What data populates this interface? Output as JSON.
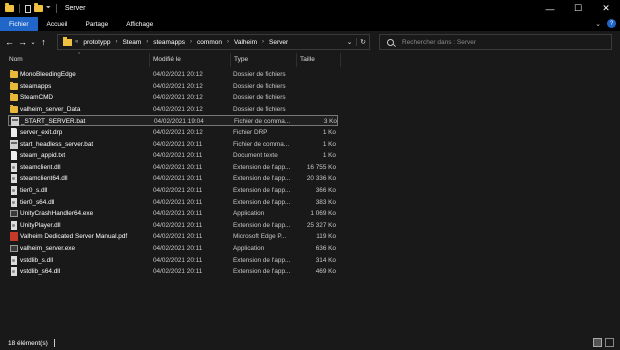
{
  "window": {
    "title": "Server",
    "controls": {
      "minimize": "—",
      "maximize": "☐",
      "close": "✕"
    }
  },
  "ribbon": {
    "tabs": [
      {
        "label": "Fichier",
        "active": true
      },
      {
        "label": "Accueil",
        "active": false
      },
      {
        "label": "Partage",
        "active": false
      },
      {
        "label": "Affichage",
        "active": false
      }
    ],
    "collapse_glyph": "⌄",
    "help_glyph": "?"
  },
  "nav": {
    "back": "←",
    "forward": "→",
    "history": "⌄",
    "up": "↑",
    "more_glyph": "«",
    "breadcrumbs": [
      "prototypp",
      "Steam",
      "steamapps",
      "common",
      "Valheim",
      "Server"
    ],
    "crumb_separator": "›",
    "dropdown_glyph": "⌄",
    "refresh_glyph": "↻"
  },
  "search": {
    "placeholder": "Rechercher dans : Server"
  },
  "columns": {
    "name": "Nom",
    "modified": "Modifié le",
    "type": "Type",
    "size": "Taille"
  },
  "files": [
    {
      "name": "MonoBleedingEdge",
      "modified": "04/02/2021 20:12",
      "type": "Dossier de fichiers",
      "size": "",
      "icon": "folder"
    },
    {
      "name": "steamapps",
      "modified": "04/02/2021 20:12",
      "type": "Dossier de fichiers",
      "size": "",
      "icon": "folder"
    },
    {
      "name": "SteamCMD",
      "modified": "04/02/2021 20:12",
      "type": "Dossier de fichiers",
      "size": "",
      "icon": "folder"
    },
    {
      "name": "valheim_server_Data",
      "modified": "04/02/2021 20:12",
      "type": "Dossier de fichiers",
      "size": "",
      "icon": "folder"
    },
    {
      "name": "_START_SERVER.bat",
      "modified": "04/02/2021 19:04",
      "type": "Fichier de comma...",
      "size": "3 Ko",
      "icon": "bat",
      "selected": true
    },
    {
      "name": "server_exit.drp",
      "modified": "04/02/2021 20:12",
      "type": "Fichier DRP",
      "size": "1 Ko",
      "icon": "doc"
    },
    {
      "name": "start_headless_server.bat",
      "modified": "04/02/2021 20:11",
      "type": "Fichier de comma...",
      "size": "1 Ko",
      "icon": "bat"
    },
    {
      "name": "steam_appid.txt",
      "modified": "04/02/2021 20:11",
      "type": "Document texte",
      "size": "1 Ko",
      "icon": "doc"
    },
    {
      "name": "steamclient.dll",
      "modified": "04/02/2021 20:11",
      "type": "Extension de l'app...",
      "size": "16 755 Ko",
      "icon": "dll"
    },
    {
      "name": "steamclient64.dll",
      "modified": "04/02/2021 20:11",
      "type": "Extension de l'app...",
      "size": "20 336 Ko",
      "icon": "dll"
    },
    {
      "name": "tier0_s.dll",
      "modified": "04/02/2021 20:11",
      "type": "Extension de l'app...",
      "size": "366 Ko",
      "icon": "dll"
    },
    {
      "name": "tier0_s64.dll",
      "modified": "04/02/2021 20:11",
      "type": "Extension de l'app...",
      "size": "383 Ko",
      "icon": "dll"
    },
    {
      "name": "UnityCrashHandler64.exe",
      "modified": "04/02/2021 20:11",
      "type": "Application",
      "size": "1 069 Ko",
      "icon": "exe"
    },
    {
      "name": "UnityPlayer.dll",
      "modified": "04/02/2021 20:11",
      "type": "Extension de l'app...",
      "size": "25 327 Ko",
      "icon": "dll"
    },
    {
      "name": "Valheim Dedicated Server Manual.pdf",
      "modified": "04/02/2021 20:11",
      "type": "Microsoft Edge P...",
      "size": "119 Ko",
      "icon": "pdf"
    },
    {
      "name": "valheim_server.exe",
      "modified": "04/02/2021 20:11",
      "type": "Application",
      "size": "636 Ko",
      "icon": "exe"
    },
    {
      "name": "vstdlib_s.dll",
      "modified": "04/02/2021 20:11",
      "type": "Extension de l'app...",
      "size": "314 Ko",
      "icon": "dll"
    },
    {
      "name": "vstdlib_s64.dll",
      "modified": "04/02/2021 20:11",
      "type": "Extension de l'app...",
      "size": "469 Ko",
      "icon": "dll"
    }
  ],
  "status": {
    "text": "18 élément(s)"
  },
  "colors": {
    "background": "#191919",
    "accent": "#1f66c8",
    "folder": "#e8b838"
  }
}
